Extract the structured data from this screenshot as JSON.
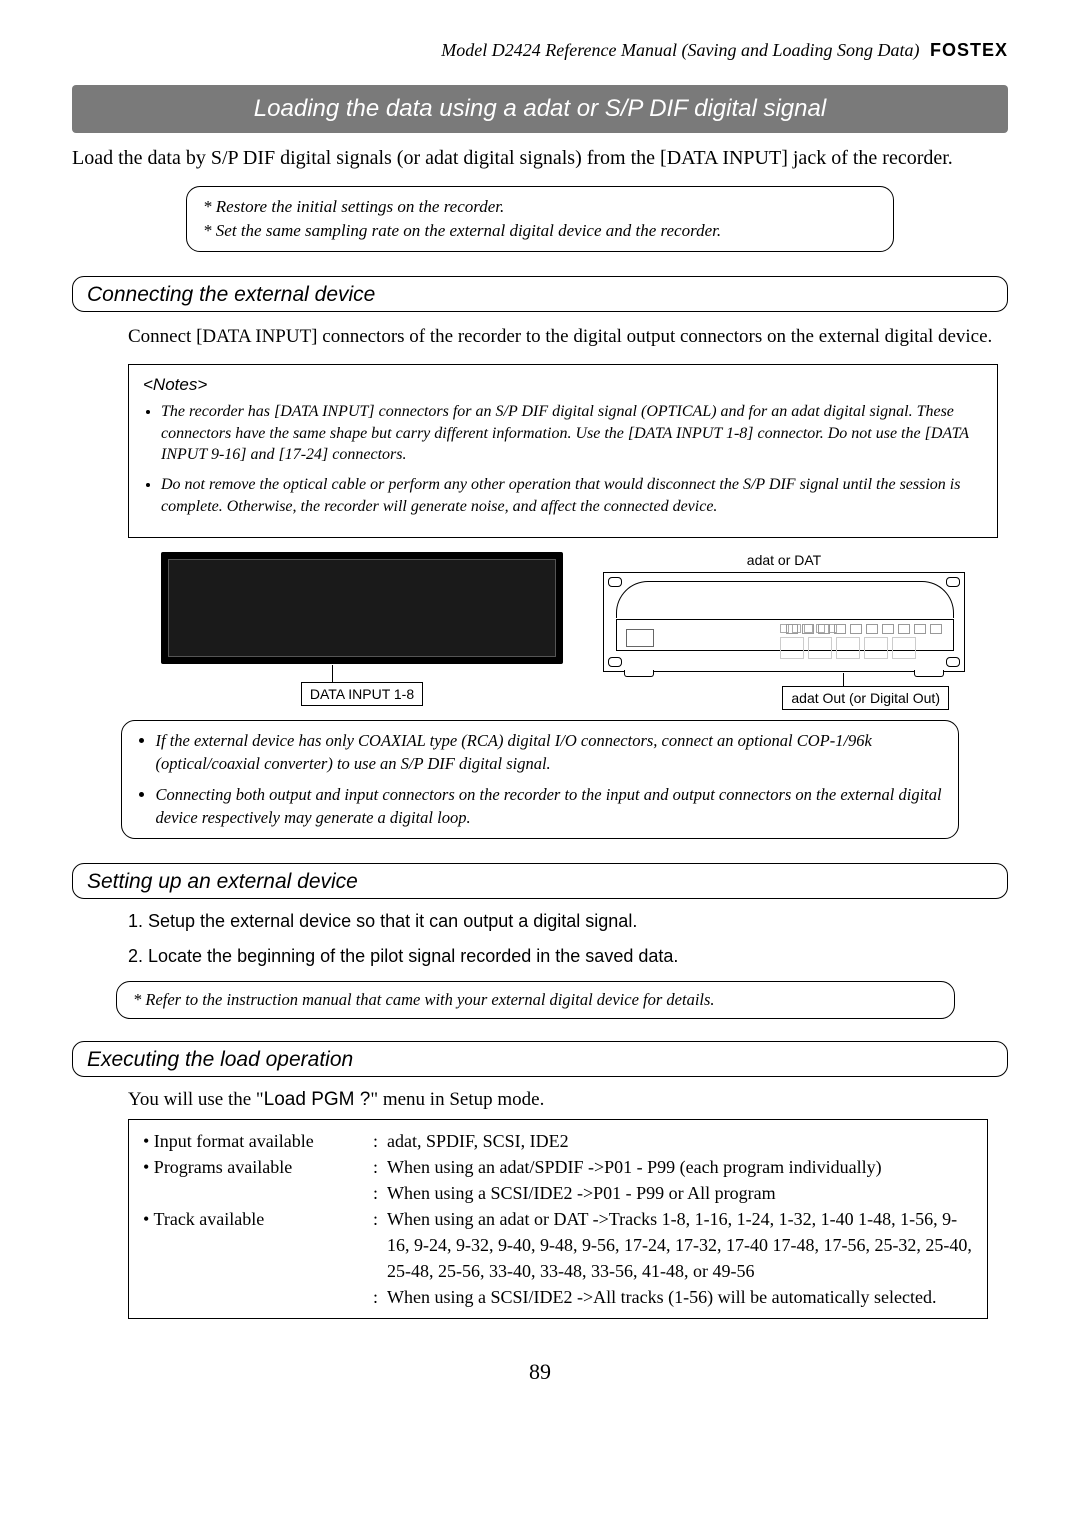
{
  "header": {
    "line": "Model D2424  Reference Manual (Saving and Loading Song Data)",
    "brand": "FOSTEX"
  },
  "title_bar": "Loading the data using a adat or S/P DIF digital signal",
  "intro": "Load the data by S/P DIF digital signals (or adat digital signals) from the [DATA INPUT] jack of the recorder.",
  "restore_box": {
    "line1": "* Restore the initial settings on the recorder.",
    "line2": "* Set the same sampling rate on the external digital device and the recorder."
  },
  "section1": {
    "heading": "Connecting the external device",
    "body": "Connect [DATA INPUT] connectors of the recorder to the digital output connectors on the external digital device.",
    "notes_title": "<Notes>",
    "note1": "The recorder has [DATA INPUT] connectors for an S/P DIF digital signal (OPTICAL) and for an adat digital signal.  These connectors have the same shape but carry different information. Use the [DATA INPUT 1-8] connector.  Do not use the [DATA INPUT 9-16] and [17-24] connectors.",
    "note2": "Do not remove the optical cable or perform any other operation that would disconnect the S/P DIF signal until the session is complete.  Otherwise, the recorder will generate noise, and affect the connected device.",
    "diagram": {
      "dat_label": "adat or DAT",
      "callout_left": "DATA INPUT 1-8",
      "callout_right": "adat Out (or Digital Out)"
    },
    "post_note1": "If the external device has only COAXIAL type (RCA) digital I/O connectors, connect an optional COP-1/96k (optical/coaxial converter) to use an S/P DIF digital signal.",
    "post_note2": "Connecting both output and input connectors on the recorder to the input and output connectors on the external digital device respectively may generate a digital loop."
  },
  "section2": {
    "heading": "Setting up an external device",
    "step1": "Setup the external device so that it can output a digital signal.",
    "step2": "Locate the beginning of the pilot signal recorded in the saved data.",
    "ref": "* Refer to the instruction manual that came with your external digital device for details."
  },
  "section3": {
    "heading": "Executing the load operation",
    "intro_pre": "You will use the \"",
    "intro_menu": "Load PGM ?",
    "intro_post": "\" menu in Setup mode.",
    "spec": {
      "row1_label": "• Input format available",
      "row1_val": "adat, SPDIF, SCSI, IDE2",
      "row2_label": "• Programs available",
      "row2_val1": "When using an adat/SPDIF  ->P01 - P99 (each program individually)",
      "row2_val2": "When using a SCSI/IDE2    ->P01 - P99 or All program",
      "row3_label": "• Track available",
      "row3_val1": "When using an adat or DAT ->Tracks 1-8, 1-16, 1-24, 1-32, 1-40 1-48, 1-56, 9-16, 9-24, 9-32, 9-40, 9-48, 9-56, 17-24, 17-32, 17-40 17-48, 17-56, 25-32, 25-40, 25-48, 25-56, 33-40, 33-48, 33-56, 41-48, or 49-56",
      "row3_val2": "When using a SCSI/IDE2    ->All tracks (1-56) will be automatically selected."
    }
  },
  "page_number": "89"
}
